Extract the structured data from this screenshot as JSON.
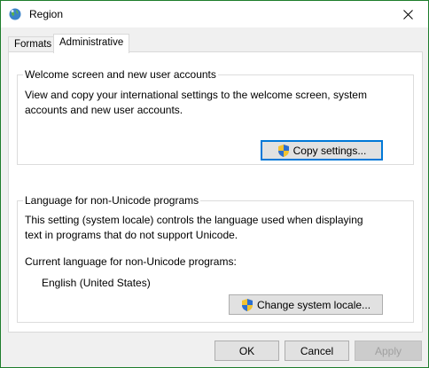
{
  "window": {
    "title": "Region",
    "close_icon": "close-icon",
    "app_icon": "globe-icon"
  },
  "tabs": [
    {
      "label": "Formats",
      "active": false
    },
    {
      "label": "Administrative",
      "active": true
    }
  ],
  "welcome_group": {
    "label": "Welcome screen and new user accounts",
    "description_line1": "View and copy your international settings to the welcome screen, system",
    "description_line2": "accounts and new user accounts.",
    "copy_button": "Copy settings..."
  },
  "language_group": {
    "label": "Language for non-Unicode programs",
    "description_line1": "This setting (system locale) controls the language used when displaying",
    "description_line2": "text in programs that do not support Unicode.",
    "current_label": "Current language for non-Unicode programs:",
    "current_value": "English (United States)",
    "change_button": "Change system locale..."
  },
  "footer": {
    "ok": "OK",
    "cancel": "Cancel",
    "apply": "Apply"
  },
  "colors": {
    "window_border": "#1e7d2c",
    "focus": "#0078d7"
  }
}
